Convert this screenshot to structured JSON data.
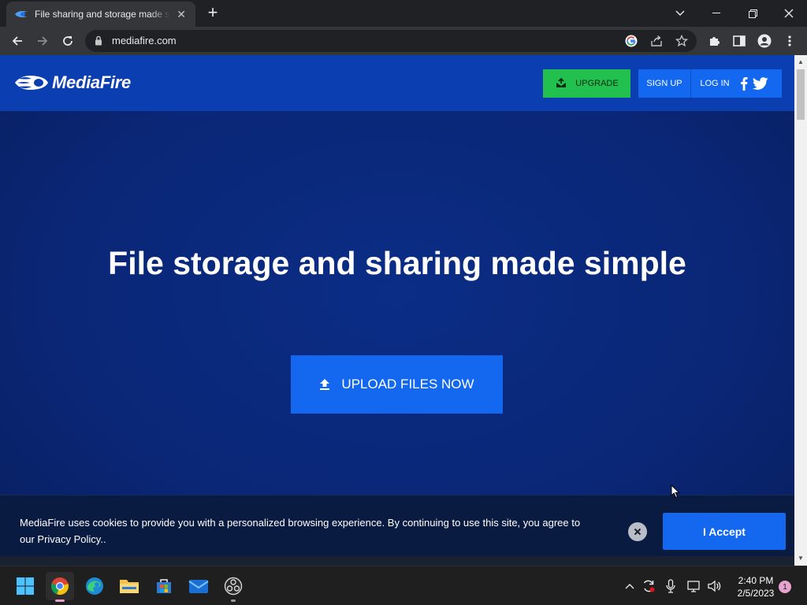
{
  "browser": {
    "tab_title": "File sharing and storage made simple",
    "tab_close": "✕",
    "new_tab": "+",
    "url": "mediafire.com"
  },
  "header": {
    "logo_text": "MediaFire",
    "upgrade_label": "UPGRADE",
    "signup_label": "SIGN UP",
    "login_label": "LOG IN"
  },
  "hero": {
    "title": "File storage and sharing made simple",
    "upload_label": "UPLOAD FILES NOW"
  },
  "cookie_banner": {
    "message": "MediaFire uses cookies to provide you with a personalized browsing experience. By continuing to use this site, you agree to our Privacy Policy..",
    "accept_label": "I Accept"
  },
  "taskbar": {
    "time": "2:40 PM",
    "date": "2/5/2023",
    "notification_count": "1"
  },
  "colors": {
    "header_blue": "#0b3fb1",
    "hero_blue": "#0a2676",
    "accent_blue": "#1468f0",
    "upgrade_green": "#22c14f",
    "cookie_bg": "#0a1b42"
  },
  "icons": {
    "tab_favicon": "mediafire-flame-icon",
    "back": "arrow-left-icon",
    "forward": "arrow-right-icon",
    "reload": "reload-icon",
    "lock": "lock-icon",
    "google": "google-icon",
    "share": "share-icon",
    "bookmark": "star-icon",
    "extensions": "puzzle-icon",
    "side_panel": "side-panel-icon",
    "profile": "profile-icon",
    "menu": "kebab-menu-icon",
    "upload": "upload-arrow-icon",
    "close_cookie": "close-circle-icon",
    "facebook": "facebook-icon",
    "twitter": "twitter-icon"
  }
}
